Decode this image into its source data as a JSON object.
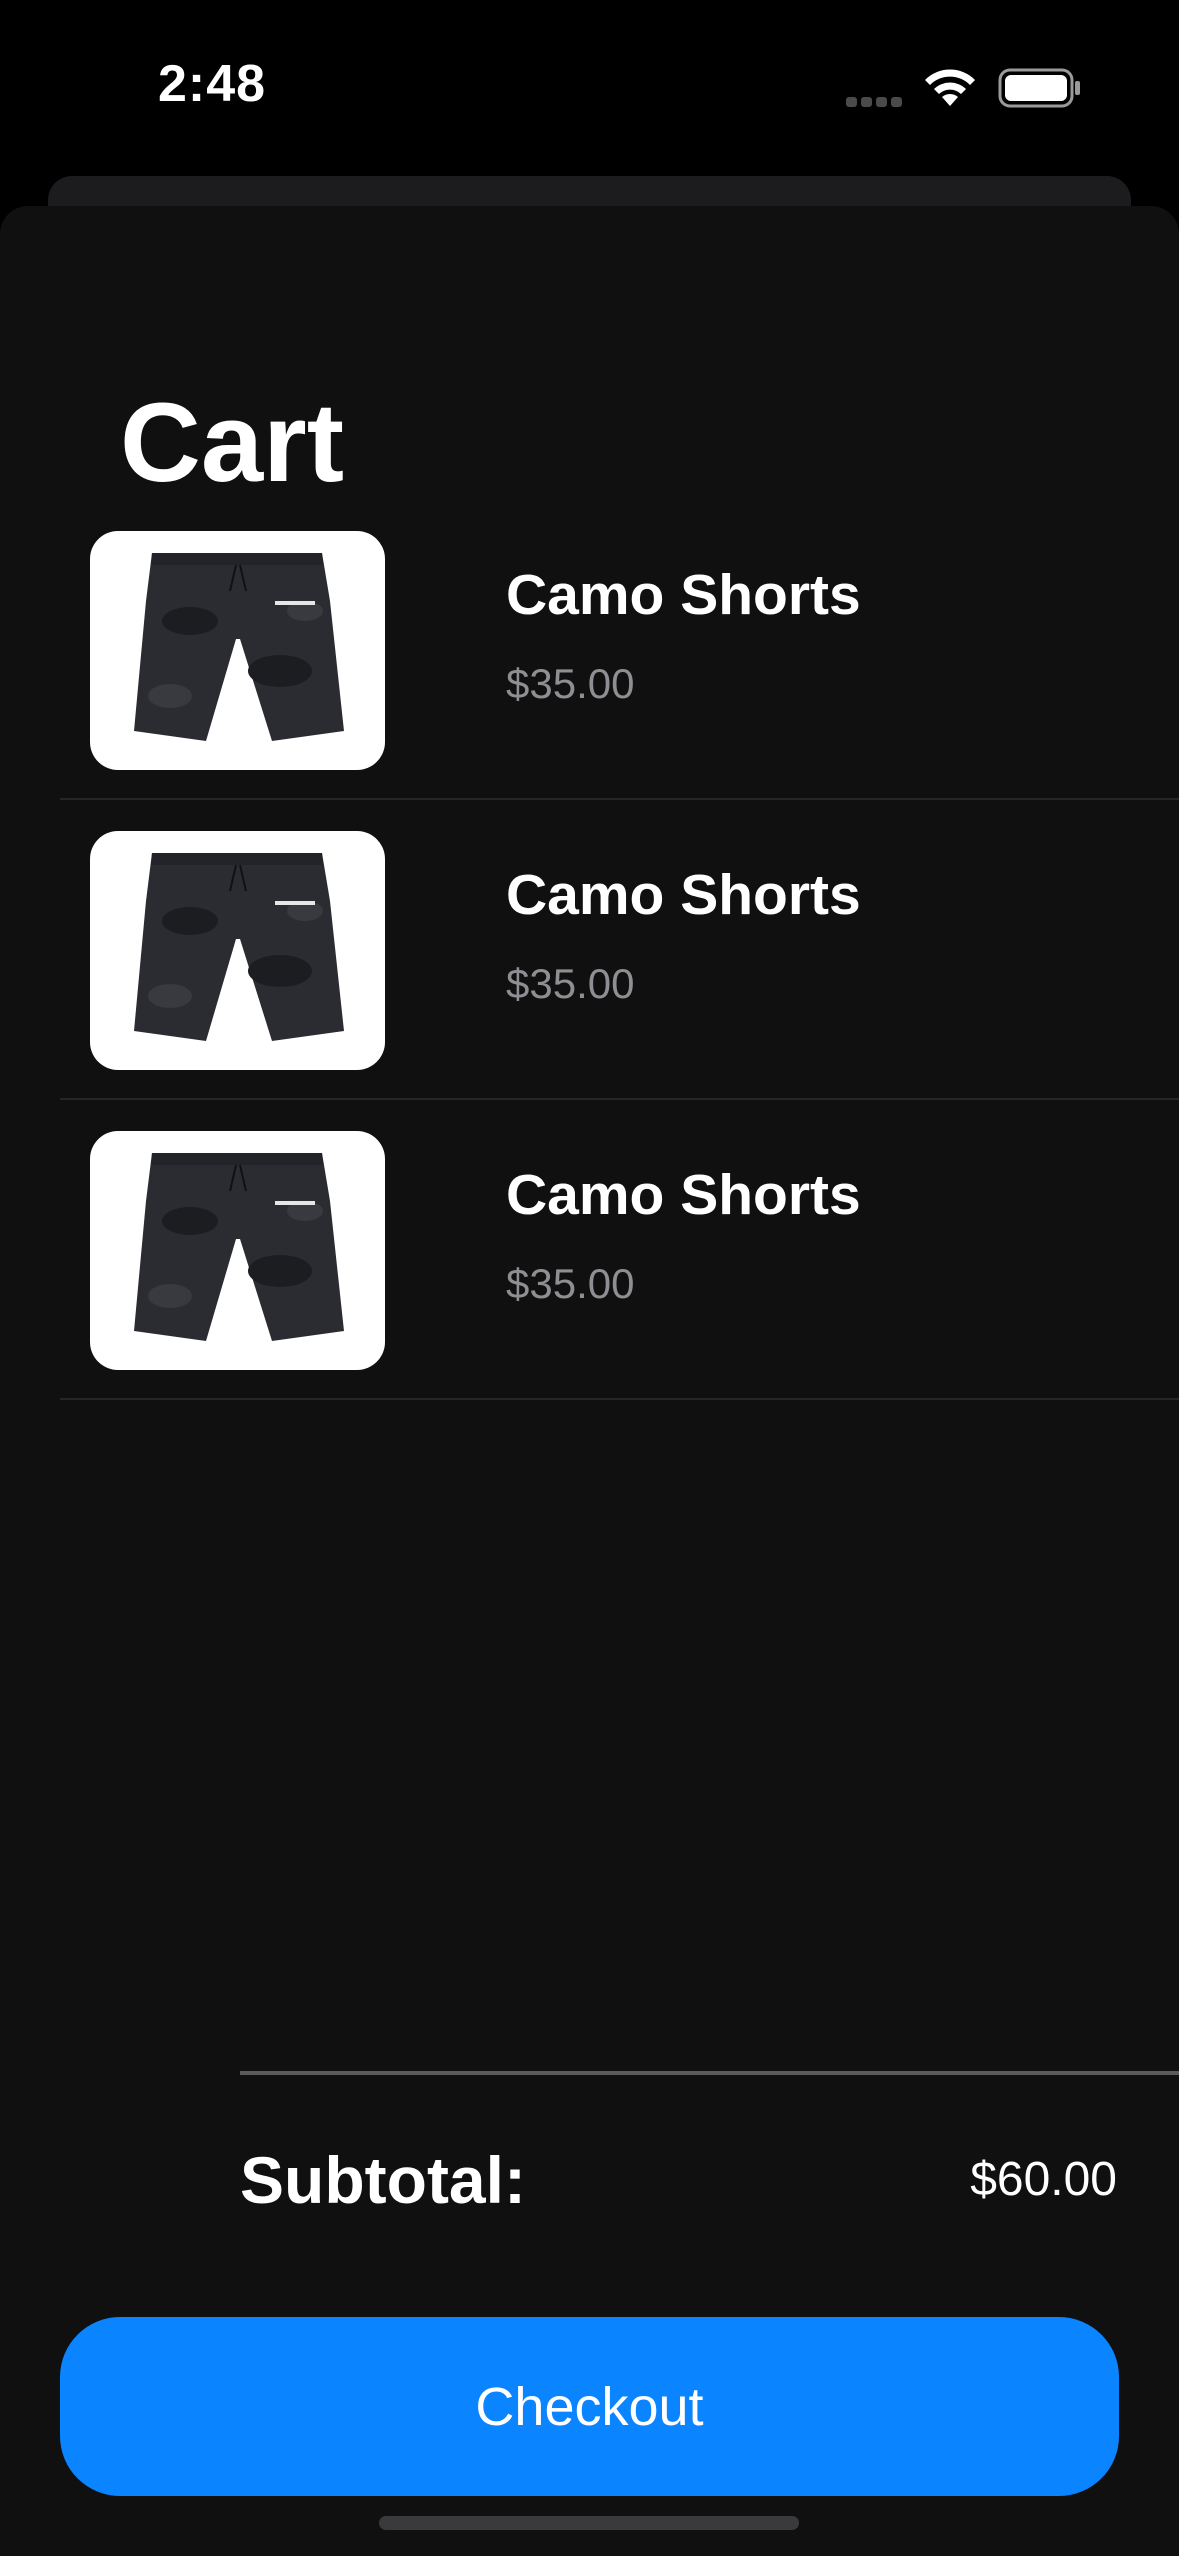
{
  "status_bar": {
    "time": "2:48",
    "icons": [
      "cellular-signal-icon",
      "wifi-icon",
      "battery-icon"
    ]
  },
  "page": {
    "title": "Cart"
  },
  "cart": {
    "items": [
      {
        "name": "Camo Shorts",
        "price": "$35.00",
        "image": "camo-shorts-image"
      },
      {
        "name": "Camo Shorts",
        "price": "$35.00",
        "image": "camo-shorts-image"
      },
      {
        "name": "Camo Shorts",
        "price": "$35.00",
        "image": "camo-shorts-image"
      }
    ]
  },
  "summary": {
    "subtotal_label": "Subtotal:",
    "subtotal_value": "$60.00"
  },
  "actions": {
    "checkout_label": "Checkout"
  },
  "colors": {
    "background": "#000000",
    "sheet": "#101010",
    "accent": "#0a84ff",
    "secondary_text": "#8e8e93"
  }
}
